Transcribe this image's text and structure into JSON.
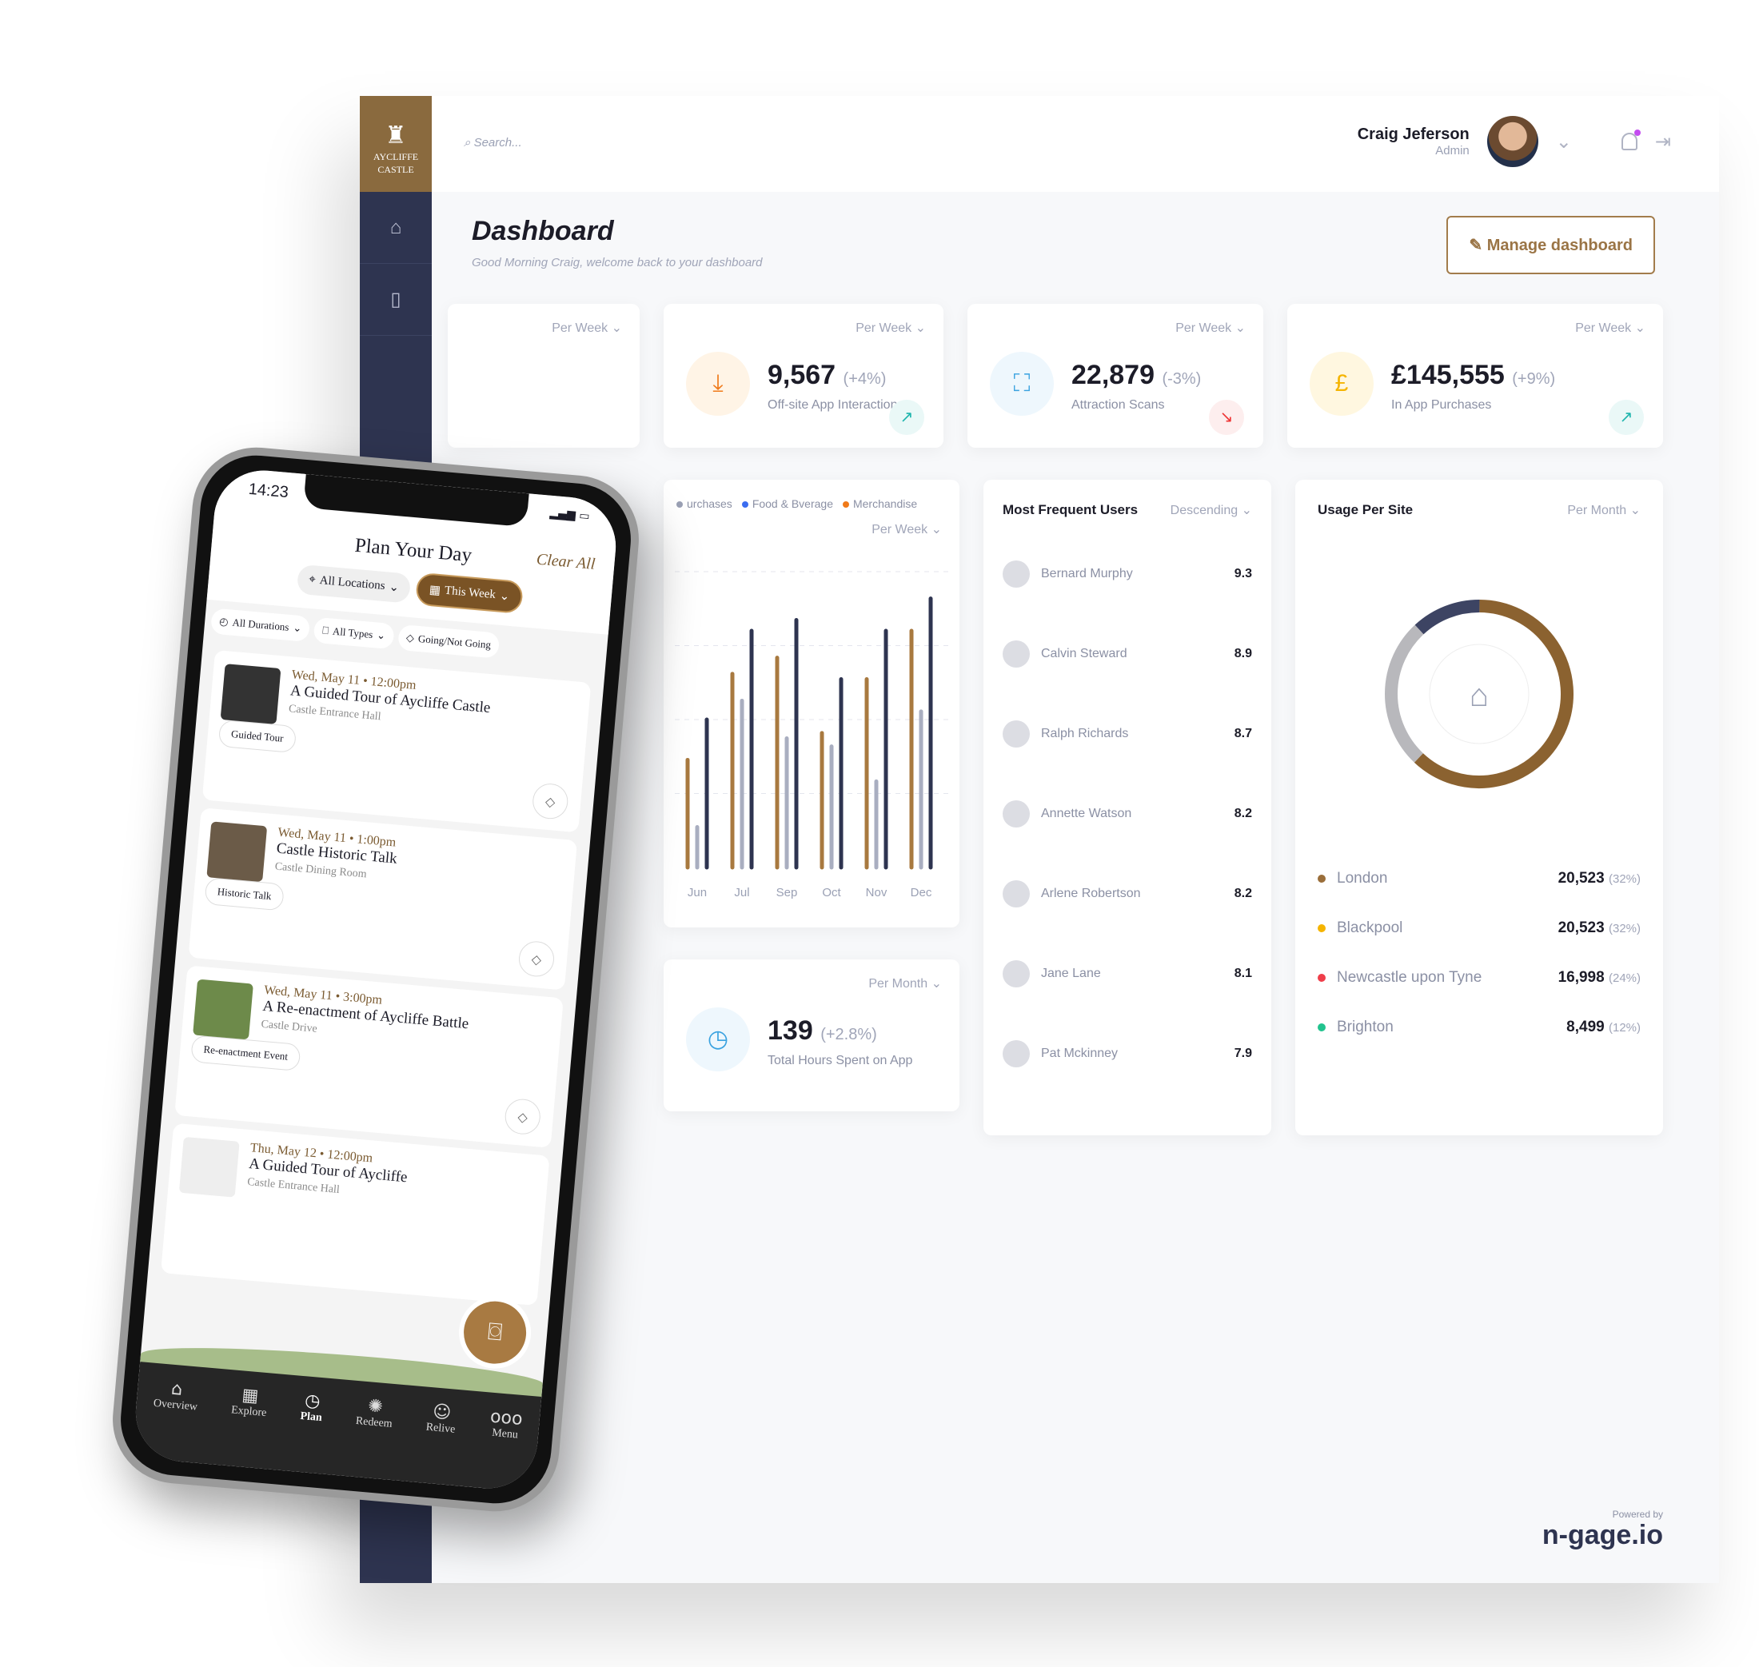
{
  "dashboard": {
    "logo": "AYCLIFFE CASTLE",
    "search_placeholder": "Search...",
    "user": {
      "name": "Craig Jeferson",
      "role": "Admin"
    },
    "title": "Dashboard",
    "subtitle": "Good Morning Craig, welcome back to your dashboard",
    "manage_label": "Manage dashboard",
    "stats": [
      {
        "period": "Per Week",
        "value": "",
        "change": "",
        "label": ""
      },
      {
        "period": "Per Week",
        "value": "9,567",
        "change": "(+4%)",
        "label": "Off-site App Interactions",
        "icon": "download-icon",
        "trend": "up"
      },
      {
        "period": "Per Week",
        "value": "22,879",
        "change": "(-3%)",
        "label": "Attraction Scans",
        "icon": "scan-icon",
        "trend": "down"
      },
      {
        "period": "Per Week",
        "value": "£145,555",
        "change": "(+9%)",
        "label": "In App Purchases",
        "icon": "pound-icon",
        "trend": "up"
      }
    ],
    "hours": {
      "period": "Per Month",
      "value": "139",
      "change": "(+2.8%)",
      "label": "Total Hours Spent on App"
    },
    "users": {
      "title": "Most Frequent Users",
      "sort": "Descending",
      "items": [
        {
          "name": "Bernard Murphy",
          "score": "9.3"
        },
        {
          "name": "Calvin Steward",
          "score": "8.9"
        },
        {
          "name": "Ralph Richards",
          "score": "8.7"
        },
        {
          "name": "Annette Watson",
          "score": "8.2"
        },
        {
          "name": "Arlene Robertson",
          "score": "8.2"
        },
        {
          "name": "Jane Lane",
          "score": "8.1"
        },
        {
          "name": "Pat Mckinney",
          "score": "7.9"
        }
      ]
    },
    "usage": {
      "title": "Usage Per Site",
      "period": "Per Month",
      "sites": [
        {
          "name": "London",
          "value": "20,523",
          "pct": "(32%)",
          "color": "#9a6e3a"
        },
        {
          "name": "Blackpool",
          "value": "20,523",
          "pct": "(32%)",
          "color": "#f5b400"
        },
        {
          "name": "Newcastle upon Tyne",
          "value": "16,998",
          "pct": "(24%)",
          "color": "#ef3e4a"
        },
        {
          "name": "Brighton",
          "value": "8,499",
          "pct": "(12%)",
          "color": "#22c38e"
        }
      ],
      "donut": [
        {
          "share": 0.62,
          "color": "#8b6230"
        },
        {
          "share": 0.26,
          "color": "#b8b8bc"
        },
        {
          "share": 0.12,
          "color": "#3d4463"
        }
      ]
    },
    "powered_by": "Powered by",
    "brand": "n-gage.io"
  },
  "chart_data": {
    "type": "bar",
    "period": "Per Week",
    "legend": [
      {
        "name": "urchases",
        "color": "#9aa0b4"
      },
      {
        "name": "Food & Bverage",
        "color": "#3b6df0"
      },
      {
        "name": "Merchandise",
        "color": "#f07a1a"
      }
    ],
    "categories": [
      "Jun",
      "Jul",
      "Sep",
      "Oct",
      "Nov",
      "Dec"
    ],
    "series": [
      {
        "color": "#a8793f",
        "values": [
          40,
          72,
          78,
          50,
          70,
          88
        ]
      },
      {
        "color": "#a9aec0",
        "values": [
          15,
          62,
          48,
          45,
          32,
          58
        ]
      },
      {
        "color": "#2e3450",
        "values": [
          55,
          88,
          92,
          70,
          88,
          100
        ]
      }
    ],
    "ylim": [
      0,
      110
    ]
  },
  "phone": {
    "time": "14:23",
    "title": "Plan Your Day",
    "clear": "Clear All",
    "location": "All Locations",
    "week": "This Week",
    "filters": [
      "All Durations",
      "All Types",
      "Going/Not Going"
    ],
    "events": [
      {
        "date": "Wed, May 11 • 12:00pm",
        "title": "A Guided Tour of Aycliffe Castle",
        "loc": "Castle Entrance Hall",
        "tag": "Guided Tour",
        "thumb": "#333"
      },
      {
        "date": "Wed, May 11 • 1:00pm",
        "title": "Castle Historic Talk",
        "loc": "Castle Dining Room",
        "tag": "Historic Talk",
        "thumb": "#6b5b48"
      },
      {
        "date": "Wed, May 11 • 3:00pm",
        "title": "A Re-enactment of Aycliffe Battle",
        "loc": "Castle Drive",
        "tag": "Re-enactment Event",
        "thumb": "#6d8a4a"
      },
      {
        "date": "Thu, May 12 • 12:00pm",
        "title": "A Guided Tour of Aycliffe",
        "loc": "Castle Entrance Hall",
        "tag": "",
        "thumb": "#eee"
      }
    ],
    "nav": [
      {
        "label": "Overview",
        "icon": "⌂"
      },
      {
        "label": "Explore",
        "icon": "▦"
      },
      {
        "label": "Plan",
        "icon": "◷"
      },
      {
        "label": "Redeem",
        "icon": "✺"
      },
      {
        "label": "Relive",
        "icon": "☺"
      },
      {
        "label": "Menu",
        "icon": "ooo"
      }
    ]
  }
}
